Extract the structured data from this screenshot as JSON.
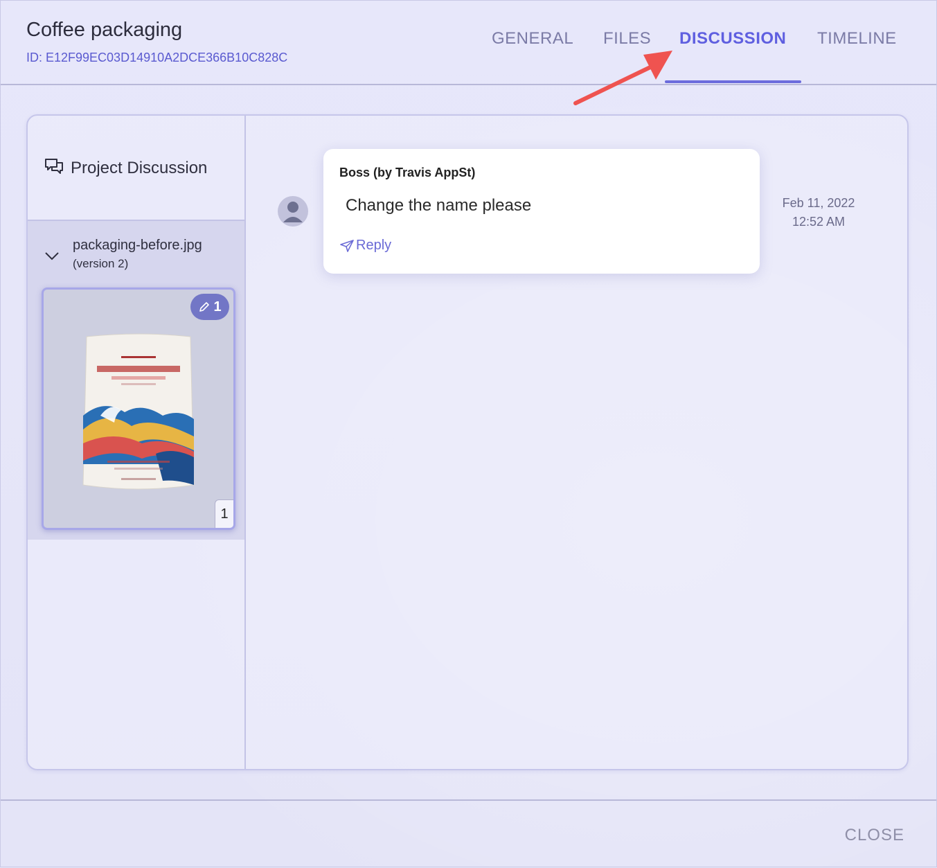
{
  "header": {
    "title": "Coffee packaging",
    "id_text": "ID: E12F99EC03D14910A2DCE366B10C828C",
    "tabs": [
      {
        "label": "GENERAL",
        "active": false
      },
      {
        "label": "FILES",
        "active": false
      },
      {
        "label": "DISCUSSION",
        "active": true
      },
      {
        "label": "TIMELINE",
        "active": false
      }
    ]
  },
  "sidebar": {
    "discussion_label": "Project Discussion",
    "file": {
      "name": "packaging-before.jpg",
      "version": "(version 2)",
      "annotation_count": "1",
      "page": "1"
    }
  },
  "comment": {
    "author": "Boss (by Travis AppSt)",
    "text": "Change the name please",
    "reply_label": "Reply",
    "date": "Feb 11, 2022",
    "time": "12:52 AM"
  },
  "footer": {
    "close_label": "CLOSE"
  },
  "colors": {
    "accent": "#5f5fe0",
    "annotation_arrow": "#ef5350"
  }
}
